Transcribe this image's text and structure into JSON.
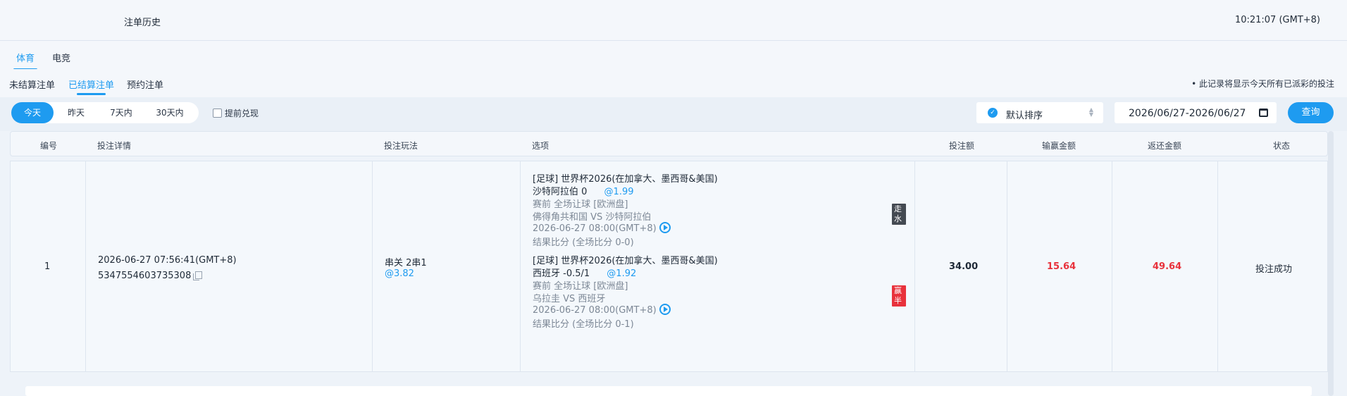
{
  "header": {
    "title": "注单历史",
    "clock": "10:21:07 (GMT+8)"
  },
  "sport_tabs": [
    {
      "label": "体育",
      "active": true
    },
    {
      "label": "电竞",
      "active": false
    }
  ],
  "status_tabs": [
    {
      "label": "未结算注单",
      "active": false
    },
    {
      "label": "已结算注单",
      "active": true
    },
    {
      "label": "预约注单",
      "active": false
    }
  ],
  "notice": "• 此记录将显示今天所有已派彩的投注",
  "filters": {
    "ranges": [
      "今天",
      "昨天",
      "7天内",
      "30天内"
    ],
    "active_range": "今天",
    "early_cashout_label": "提前兑现",
    "early_cashout_checked": false,
    "sort_label": "默认排序",
    "date_range": "2026/06/27-2026/06/27",
    "query_label": "查询"
  },
  "table": {
    "columns": [
      "编号",
      "投注详情",
      "投注玩法",
      "选项",
      "投注额",
      "输赢金额",
      "返还金额",
      "状态"
    ],
    "rows": [
      {
        "index": "1",
        "time": "2026-06-27 07:56:41(GMT+8)",
        "bet_id": "5347554603735308",
        "play_type": "串关 2串1",
        "play_odds": "@3.82",
        "legs": [
          {
            "league": "[足球] 世界杯2026(在加拿大、墨西哥&美国)",
            "selection": "沙特阿拉伯 0",
            "odds": "@1.99",
            "market": "赛前 全场让球 [欧洲盘]",
            "teams": "佛得角共和国 VS 沙特阿拉伯",
            "kickoff": "2026-06-27 08:00(GMT+8)",
            "score": "结果比分 (全场比分 0-0)",
            "result": "走水",
            "result_color": "#444a52"
          },
          {
            "league": "[足球] 世界杯2026(在加拿大、墨西哥&美国)",
            "selection": "西班牙 -0.5/1",
            "odds": "@1.92",
            "market": "赛前 全场让球 [欧洲盘]",
            "teams": "乌拉圭 VS 西班牙",
            "kickoff": "2026-06-27 08:00(GMT+8)",
            "score": "结果比分 (全场比分 0-1)",
            "result": "赢半",
            "result_color": "#e8323c"
          }
        ],
        "stake": "34.00",
        "win_loss": "15.64",
        "return": "49.64",
        "status": "投注成功"
      }
    ]
  },
  "colors": {
    "accent": "#1e9bf0",
    "win": "#e8323c",
    "background": "#eef3f9"
  }
}
